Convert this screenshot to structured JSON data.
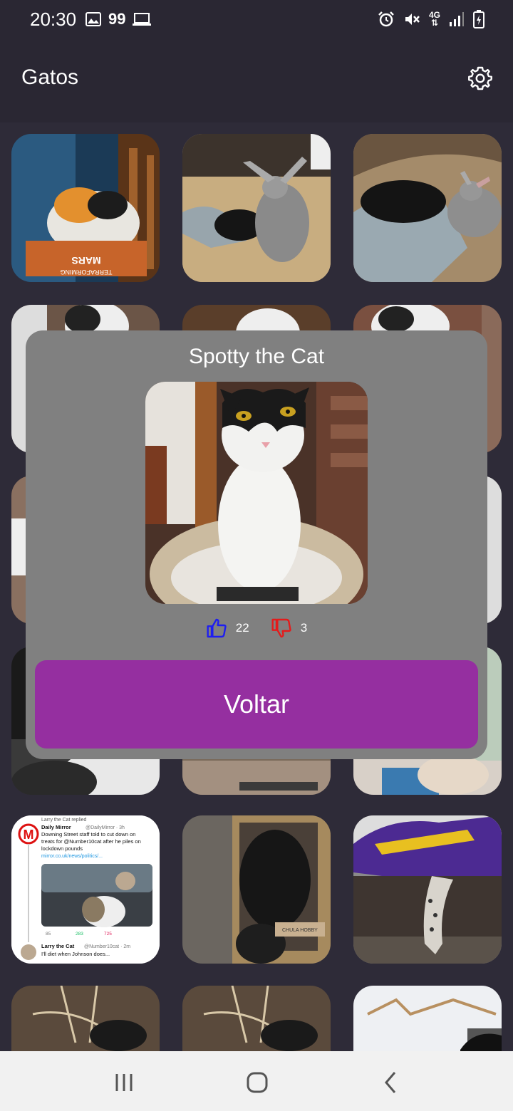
{
  "status_bar": {
    "time": "20:30",
    "notification_count": "99",
    "network": "4G",
    "icons": [
      "gallery-icon",
      "laptop-icon",
      "alarm-icon",
      "mute-icon",
      "signal-icon",
      "battery-icon"
    ]
  },
  "app_bar": {
    "title": "Gatos",
    "settings_icon": "gear-icon"
  },
  "grid": {
    "tiles": [
      {
        "alt": "calico-cat-in-box"
      },
      {
        "alt": "black-cat-and-rabbit"
      },
      {
        "alt": "black-cat-and-rabbit-on-blanket"
      },
      {
        "alt": "cat-photo"
      },
      {
        "alt": "cat-photo"
      },
      {
        "alt": "cat-photo"
      },
      {
        "alt": "cat-photo"
      },
      {
        "alt": "cat-photo"
      },
      {
        "alt": "cat-photo"
      },
      {
        "alt": "cat-photo"
      },
      {
        "alt": "cat-photo"
      },
      {
        "alt": "cat-photo"
      },
      {
        "alt": "tweet-screenshot"
      },
      {
        "alt": "black-cat-in-box"
      },
      {
        "alt": "cat-under-purple-blanket"
      },
      {
        "alt": "cat-photo"
      },
      {
        "alt": "cat-photo"
      },
      {
        "alt": "snowy-yard"
      }
    ]
  },
  "tweet": {
    "replied": "Larry the Cat replied",
    "author": "Daily Mirror",
    "handle": "@DailyMirror · 3h",
    "body_1": "Downing Street staff told to cut down on",
    "body_2": "treats for @Number10cat after he piles on",
    "body_3": "lockdown pounds",
    "link": "mirror.co.uk/news/politics/...",
    "stats": [
      "85",
      "283",
      "725"
    ],
    "reply_author": "Larry the Cat",
    "reply_handle": "@Number10cat · 2m",
    "reply_body": "I'll diet when Johnson does..."
  },
  "tile_labels": {
    "box_brand": "TERRAFORMING",
    "box_title": "MARS",
    "box_label": "CHULA HOBBY"
  },
  "dialog": {
    "title": "Spotty the Cat",
    "photo_alt": "white-and-black-cat-sitting-in-cat-bed",
    "likes": "22",
    "dislikes": "3",
    "like_color": "#1e1ef0",
    "dislike_color": "#e41b1b",
    "back_label": "Voltar",
    "button_color": "#952fa0"
  },
  "nav_bar": {
    "items": [
      "recent-apps-icon",
      "home-icon",
      "back-icon"
    ]
  }
}
